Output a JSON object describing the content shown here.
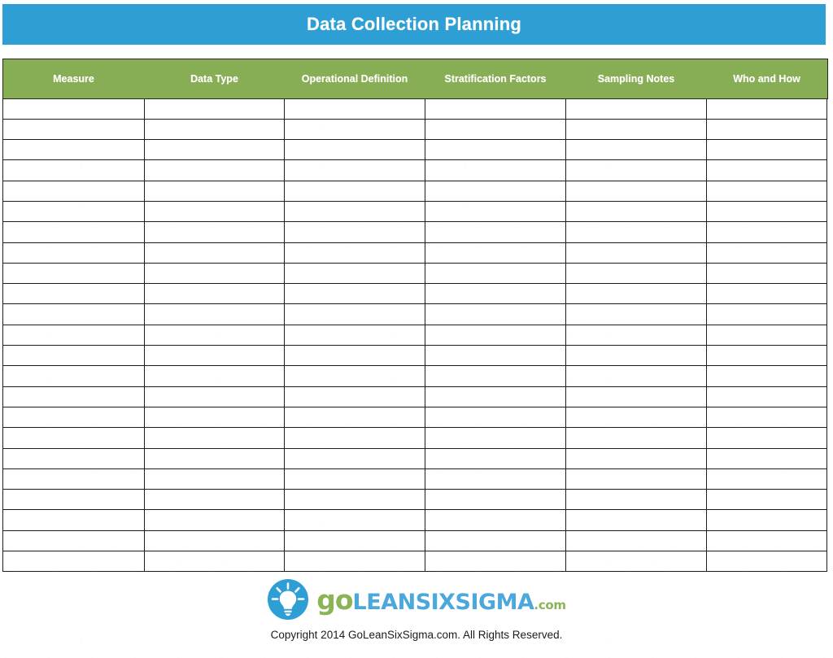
{
  "document": {
    "title": "Data Collection Planning"
  },
  "table": {
    "columns": [
      "Measure",
      "Data Type",
      "Operational Definition",
      "Stratification Factors",
      "Sampling Notes",
      "Who and How"
    ],
    "row_count": 23,
    "rows": [
      [
        "",
        "",
        "",
        "",
        "",
        ""
      ],
      [
        "",
        "",
        "",
        "",
        "",
        ""
      ],
      [
        "",
        "",
        "",
        "",
        "",
        ""
      ],
      [
        "",
        "",
        "",
        "",
        "",
        ""
      ],
      [
        "",
        "",
        "",
        "",
        "",
        ""
      ],
      [
        "",
        "",
        "",
        "",
        "",
        ""
      ],
      [
        "",
        "",
        "",
        "",
        "",
        ""
      ],
      [
        "",
        "",
        "",
        "",
        "",
        ""
      ],
      [
        "",
        "",
        "",
        "",
        "",
        ""
      ],
      [
        "",
        "",
        "",
        "",
        "",
        ""
      ],
      [
        "",
        "",
        "",
        "",
        "",
        ""
      ],
      [
        "",
        "",
        "",
        "",
        "",
        ""
      ],
      [
        "",
        "",
        "",
        "",
        "",
        ""
      ],
      [
        "",
        "",
        "",
        "",
        "",
        ""
      ],
      [
        "",
        "",
        "",
        "",
        "",
        ""
      ],
      [
        "",
        "",
        "",
        "",
        "",
        ""
      ],
      [
        "",
        "",
        "",
        "",
        "",
        ""
      ],
      [
        "",
        "",
        "",
        "",
        "",
        ""
      ],
      [
        "",
        "",
        "",
        "",
        "",
        ""
      ],
      [
        "",
        "",
        "",
        "",
        "",
        ""
      ],
      [
        "",
        "",
        "",
        "",
        "",
        ""
      ],
      [
        "",
        "",
        "",
        "",
        "",
        ""
      ],
      [
        "",
        "",
        "",
        "",
        "",
        ""
      ]
    ]
  },
  "footer": {
    "logo": {
      "icon": "lightbulb-icon",
      "word_go": "go",
      "word_lean": "LEANSIXSIGMA",
      "word_com": ".com"
    },
    "copyright": "Copyright 2014 GoLeanSixSigma.com. All Rights Reserved."
  },
  "colors": {
    "title_bar": "#2e9fd4",
    "header_band": "#87ad55",
    "logo_blue": "#2e9fd4",
    "logo_green": "#8cb356",
    "wordmark_blue": "#4aa8dc",
    "grid_line": "#1d1d1d"
  }
}
